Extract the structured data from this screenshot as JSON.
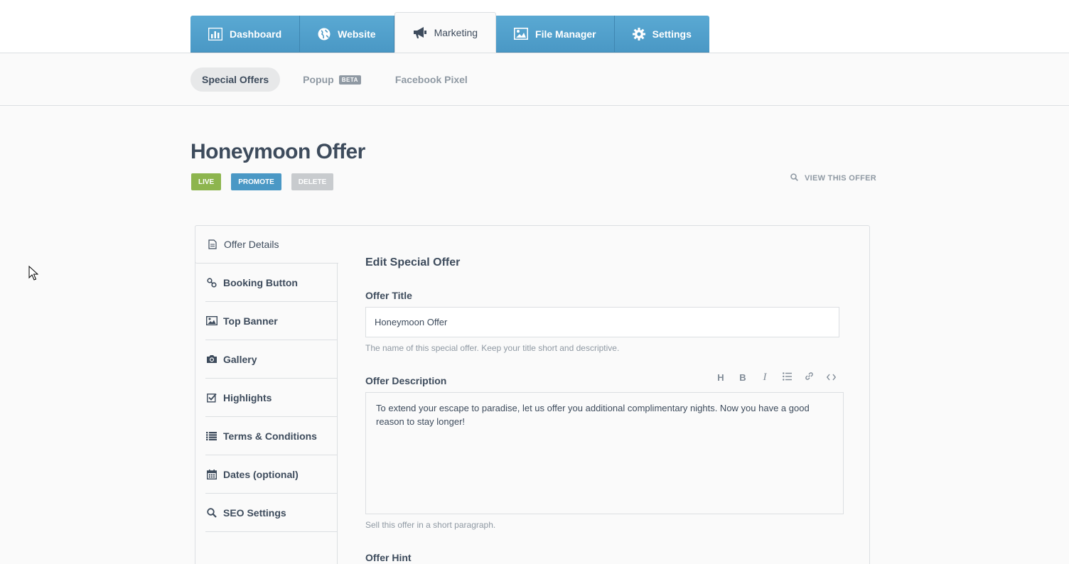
{
  "nav": {
    "tabs": [
      {
        "label": "Dashboard",
        "icon": "bar-chart-icon"
      },
      {
        "label": "Website",
        "icon": "globe-icon"
      },
      {
        "label": "Marketing",
        "icon": "megaphone-icon",
        "active": true
      },
      {
        "label": "File Manager",
        "icon": "image-icon"
      },
      {
        "label": "Settings",
        "icon": "gear-icon"
      }
    ]
  },
  "subnav": {
    "items": [
      {
        "label": "Special Offers",
        "active": true
      },
      {
        "label": "Popup",
        "badge": "BETA"
      },
      {
        "label": "Facebook Pixel"
      }
    ]
  },
  "header": {
    "title": "Honeymoon Offer",
    "badges": {
      "live": "LIVE",
      "promote": "PROMOTE",
      "delete": "DELETE"
    },
    "view_link": "VIEW THIS OFFER"
  },
  "sidemenu": {
    "items": [
      {
        "label": "Offer Details",
        "icon": "document-icon",
        "active": true
      },
      {
        "label": "Booking Button",
        "icon": "link-icon"
      },
      {
        "label": "Top Banner",
        "icon": "image-icon"
      },
      {
        "label": "Gallery",
        "icon": "camera-icon"
      },
      {
        "label": "Highlights",
        "icon": "checkbox-icon"
      },
      {
        "label": "Terms & Conditions",
        "icon": "list-icon"
      },
      {
        "label": "Dates (optional)",
        "icon": "calendar-icon"
      },
      {
        "label": "SEO Settings",
        "icon": "search-icon"
      }
    ]
  },
  "form": {
    "heading": "Edit Special Offer",
    "title_label": "Offer Title",
    "title_value": "Honeymoon Offer",
    "title_help": "The name of this special offer. Keep your title short and descriptive.",
    "desc_label": "Offer Description",
    "toolbar": {
      "heading": "H",
      "bold": "B",
      "italic": "I"
    },
    "desc_value": "To extend your escape to paradise, let us offer you additional complimentary nights. Now you have a good reason to stay longer!",
    "desc_help": "Sell this offer in a short paragraph.",
    "hint_label": "Offer Hint"
  },
  "colors": {
    "tab_blue": "#4a98c5",
    "live_green": "#8db54e",
    "text_dark": "#3d4b5c",
    "text_muted": "#8f99a3"
  }
}
